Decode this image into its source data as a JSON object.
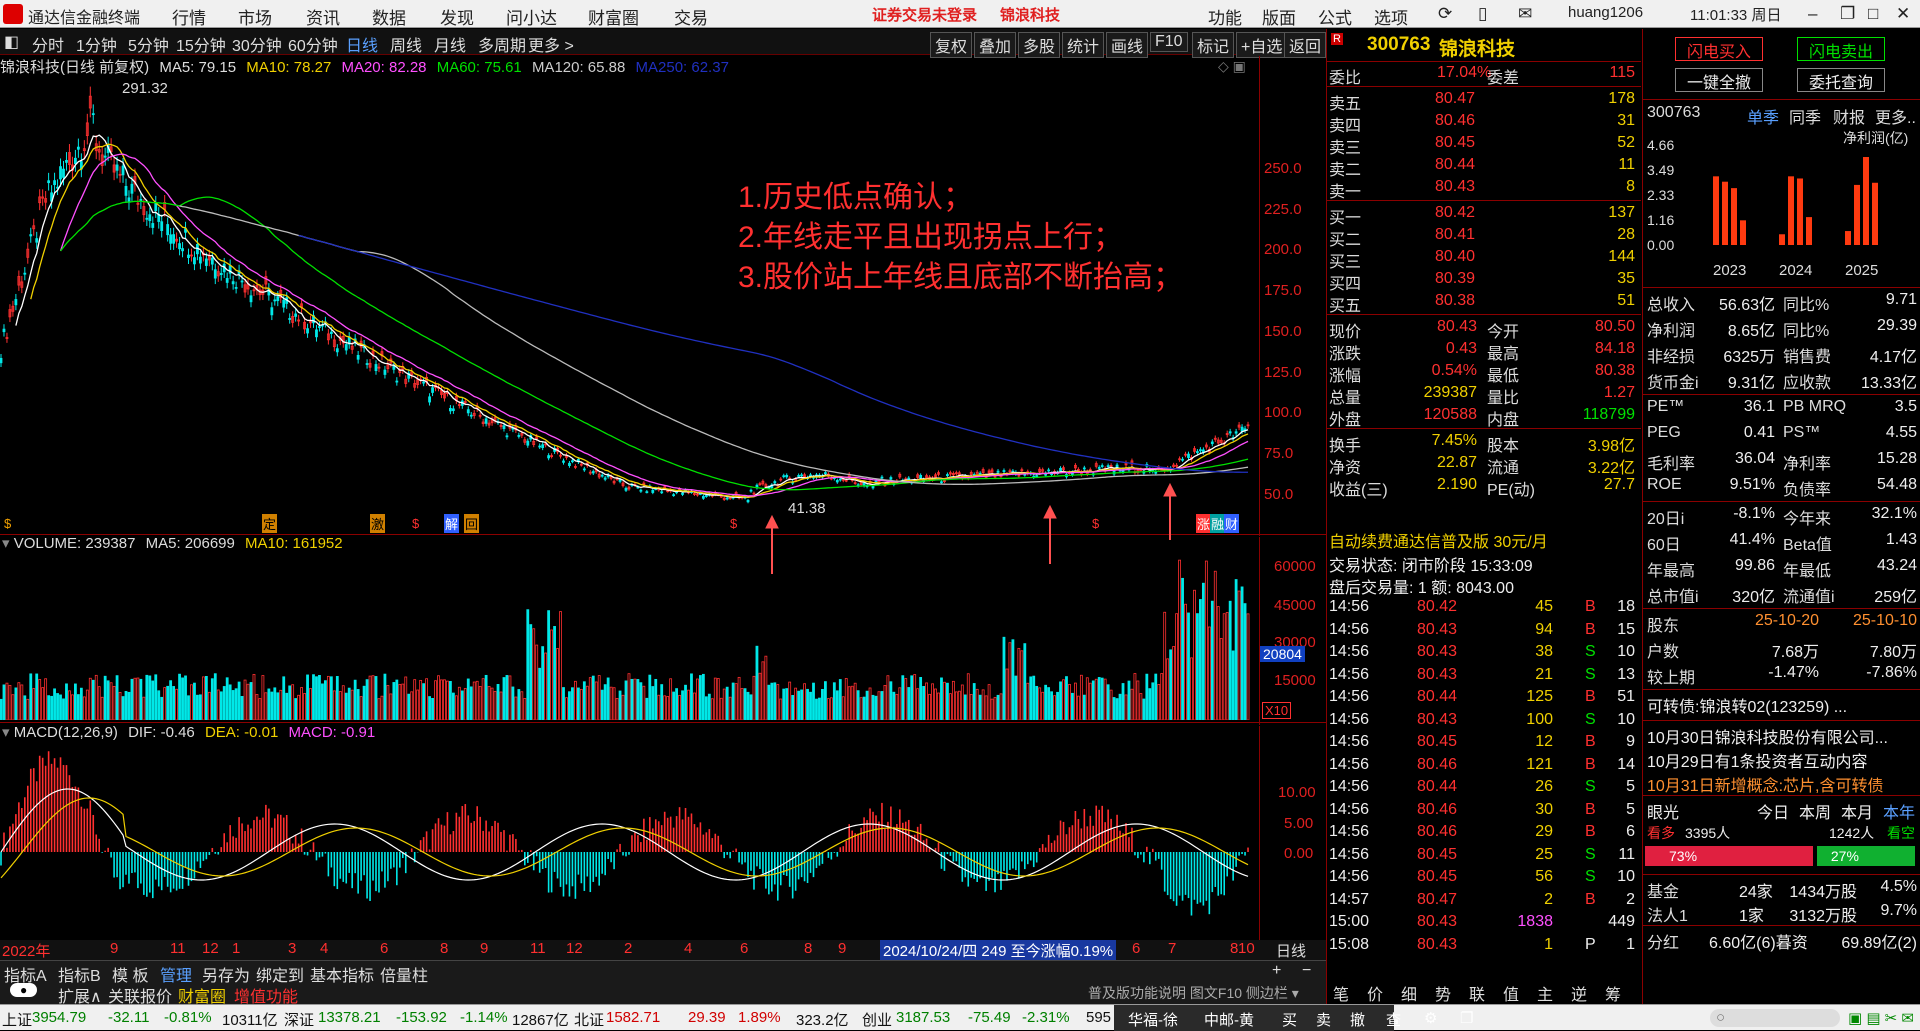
{
  "app": {
    "title": "通达信金融终端",
    "login_warning": "证券交易未登录",
    "stock_name_top": "锦浪科技",
    "user": "huang1206",
    "clock": "11:01:33 周日"
  },
  "menu": [
    "行情",
    "市场",
    "资讯",
    "数据",
    "发现",
    "问小达",
    "财富圈",
    "交易"
  ],
  "right_menu": [
    "功能",
    "版面",
    "公式",
    "选项"
  ],
  "periods": [
    "分时",
    "1分钟",
    "5分钟",
    "15分钟",
    "30分钟",
    "60分钟",
    "日线",
    "周线",
    "月线",
    "多周期",
    "更多 >"
  ],
  "tools": [
    "复权",
    "叠加",
    "多股",
    "统计",
    "画线",
    "F10",
    "标记",
    "+自选",
    "返回"
  ],
  "legend": {
    "title": "锦浪科技(日线 前复权)",
    "ma5": "MA5: 79.15",
    "ma10": "MA10: 78.27",
    "ma20": "MA20: 82.28",
    "ma60": "MA60: 75.61",
    "ma120": "MA120: 65.88",
    "ma250": "MA250: 62.37"
  },
  "price_axis": [
    "250.0",
    "225.0",
    "200.0",
    "175.0",
    "150.0",
    "125.0",
    "100.0",
    "75.0",
    "50.0"
  ],
  "annotations": {
    "high": "291.32",
    "low": "41.38",
    "line1": "1.历史低点确认；",
    "line2": "2.年线走平且出现拐点上行；",
    "line3": "3.股价站上年线且底部不断抬高；"
  },
  "markers": {
    "ding": "定",
    "ji": "激",
    "jie": "解",
    "hui": "回",
    "zhang": "涨",
    "rong": "融",
    "cai": "财"
  },
  "volume": {
    "legend_name": "VOLUME: 239387",
    "ma5": "MA5: 206699",
    "ma10": "MA10: 161952",
    "axis": [
      "60000",
      "45000",
      "30000",
      "15000"
    ],
    "current": "20804",
    "unit": "X10"
  },
  "macd": {
    "legend_name": "MACD(12,26,9)",
    "dif": "DIF: -0.46",
    "dea": "DEA: -0.01",
    "macd": "MACD: -0.91",
    "axis": [
      "10.00",
      "5.00",
      "0.00"
    ]
  },
  "date_axis": [
    "2022年",
    "9",
    "11",
    "12",
    "1",
    "3",
    "4",
    "6",
    "8",
    "9",
    "11",
    "12",
    "2",
    "4",
    "6",
    "8",
    "9",
    "6",
    "7",
    "8",
    "10"
  ],
  "date_range_note": "2024/10/24/四 249 至今涨幅0.19%",
  "period_label": "日线",
  "bottom_tabs_row1": [
    "指标A",
    "指标B",
    "模 板",
    "管理",
    "另存为",
    "绑定到",
    "基本指标",
    "倍量柱"
  ],
  "bottom_tabs_row2": [
    "扩展∧",
    "关联报价",
    "财富圈",
    "增值功能"
  ],
  "bottom_right": "普及版功能说明 图文F10 侧边栏 ▾",
  "quote": {
    "code": "300763",
    "name": "锦浪科技",
    "weibi_label": "委比",
    "weibi": "17.04%",
    "weicha_label": "委差",
    "weicha": "115",
    "sells": [
      [
        "卖五",
        "80.47",
        "178"
      ],
      [
        "卖四",
        "80.46",
        "31"
      ],
      [
        "卖三",
        "80.45",
        "52"
      ],
      [
        "卖二",
        "80.44",
        "11"
      ],
      [
        "卖一",
        "80.43",
        "8"
      ]
    ],
    "buys": [
      [
        "买一",
        "80.42",
        "137"
      ],
      [
        "买二",
        "80.41",
        "28"
      ],
      [
        "买三",
        "80.40",
        "144"
      ],
      [
        "买四",
        "80.39",
        "35"
      ],
      [
        "买五",
        "80.38",
        "51"
      ]
    ],
    "stats": [
      [
        "现价",
        "80.43",
        "今开",
        "80.50"
      ],
      [
        "涨跌",
        "0.43",
        "最高",
        "84.18"
      ],
      [
        "涨幅",
        "0.54%",
        "最低",
        "80.38"
      ],
      [
        "总量",
        "239387",
        "量比",
        "1.27"
      ],
      [
        "外盘",
        "120588",
        "内盘",
        "118799"
      ],
      [
        "换手",
        "7.45%",
        "股本",
        "3.98亿"
      ],
      [
        "净资",
        "22.87",
        "流通",
        "3.22亿"
      ],
      [
        "收益(三)",
        "2.190",
        "PE(动)",
        "27.7"
      ]
    ],
    "promo": "自动续费通达信普及版 30元/月",
    "trade_status": "交易状态: 闭市阶段 15:33:09",
    "after_hours": "盘后交易量: 1  额: 8043.00",
    "ticks": [
      [
        "14:56",
        "80.42",
        "45",
        "B",
        "18"
      ],
      [
        "14:56",
        "80.43",
        "94",
        "B",
        "15"
      ],
      [
        "14:56",
        "80.43",
        "38",
        "S",
        "10"
      ],
      [
        "14:56",
        "80.43",
        "21",
        "S",
        "13"
      ],
      [
        "14:56",
        "80.44",
        "125",
        "B",
        "51"
      ],
      [
        "14:56",
        "80.43",
        "100",
        "S",
        "10"
      ],
      [
        "14:56",
        "80.45",
        "12",
        "B",
        "9"
      ],
      [
        "14:56",
        "80.46",
        "121",
        "B",
        "14"
      ],
      [
        "14:56",
        "80.44",
        "26",
        "S",
        "5"
      ],
      [
        "14:56",
        "80.46",
        "30",
        "B",
        "5"
      ],
      [
        "14:56",
        "80.46",
        "29",
        "B",
        "6"
      ],
      [
        "14:56",
        "80.45",
        "25",
        "S",
        "11"
      ],
      [
        "14:56",
        "80.45",
        "56",
        "S",
        "10"
      ],
      [
        "14:57",
        "80.47",
        "2",
        "B",
        "2"
      ],
      [
        "15:00",
        "80.43",
        "1838",
        "",
        "449"
      ],
      [
        "15:08",
        "80.43",
        "1",
        "P",
        "1"
      ]
    ],
    "tabs": [
      "笔",
      "价",
      "细",
      "势",
      "联",
      "值",
      "主",
      "逆",
      "筹"
    ]
  },
  "info": {
    "buttons": [
      "闪电买入",
      "闪电卖出",
      "一键全撤",
      "委托查询"
    ],
    "fin_code": "300763",
    "fin_tabs": [
      "单季",
      "同季",
      "财报",
      "更多.."
    ],
    "fin_unit": "净利润(亿)",
    "fin_axis": [
      "4.66",
      "3.49",
      "2.33",
      "1.16",
      "0.00"
    ],
    "fin_years": [
      "2023",
      "2024",
      "2025"
    ],
    "fin_values": [
      3.2,
      2.95,
      2.65,
      1.15,
      0.5,
      3.2,
      3.1,
      1.3,
      0.65,
      2.8,
      4.1,
      2.9
    ],
    "rows1": [
      [
        "总收入",
        "56.63亿",
        "同比%",
        "9.71"
      ],
      [
        "净利润",
        "8.65亿",
        "同比%",
        "29.39"
      ],
      [
        "非经损",
        "6325万",
        "销售费",
        "4.17亿"
      ],
      [
        "货币金i",
        "9.31亿",
        "应收款",
        "13.33亿"
      ]
    ],
    "rows2": [
      [
        "PE™",
        "36.1",
        "PB MRQ",
        "3.5"
      ],
      [
        "PEG",
        "0.41",
        "PS™",
        "4.55"
      ],
      [
        "毛利率",
        "36.04",
        "净利率",
        "15.28"
      ],
      [
        "ROE",
        "9.51%",
        "负债率",
        "54.48"
      ]
    ],
    "rows3": [
      [
        "20日i",
        "-8.1%",
        "今年来",
        "32.1%"
      ],
      [
        "60日",
        "41.4%",
        "Beta值",
        "1.43"
      ],
      [
        "年最高",
        "99.86",
        "年最低",
        "43.24"
      ],
      [
        "总市值i",
        "320亿",
        "流通值i",
        "259亿"
      ]
    ],
    "holders": [
      [
        "股东",
        "25-10-20",
        "25-10-10"
      ],
      [
        "户数",
        "7.68万",
        "7.80万"
      ],
      [
        "较上期",
        "-1.47%",
        "-7.86%"
      ]
    ],
    "bond": "可转债:锦浪转02(123259) ...",
    "news": [
      "10月30日锦浪科技股份有限公司...",
      "10月29日有1条投资者互动内容",
      "10月31日新增概念:芯片,含可转债"
    ],
    "vision": {
      "label": "眼光",
      "tabs": [
        "今日",
        "本周",
        "本月",
        "本年"
      ],
      "bull": "看多",
      "bull_n": "3395人",
      "bear_n": "1242人",
      "bear": "看空",
      "bull_pct": 73,
      "bull_txt": "73%",
      "bear_txt": "27%"
    },
    "inst": [
      [
        "基金",
        "24家",
        "1434万股",
        "4.5%"
      ],
      [
        "法人1",
        "1家",
        "3132万股",
        "9.7%"
      ]
    ],
    "fenhong": [
      "分红",
      "6.60亿(6)暮资",
      "69.89亿(2)"
    ]
  },
  "status": {
    "sh_label": "上证",
    "sh": "3954.79",
    "sh_chg": "-32.11",
    "sh_pct": "-0.81%",
    "sh_amt": "10311亿",
    "sz_label": "深证",
    "sz": "13378.21",
    "sz_chg": "-153.92",
    "sz_pct": "-1.14%",
    "sz_amt": "12867亿",
    "bz_label": "北证",
    "bz": "1582.71",
    "bz_chg": "29.39",
    "bz_pct": "1.89%",
    "bz_amt": "323.2亿",
    "cy_label": "创业",
    "cy": "3187.53",
    "cy_chg": "-75.49",
    "cy_pct": "-2.31%",
    "cy_amt": "595",
    "tools": [
      "华福-徐",
      "中邮-黄",
      "买",
      "卖",
      "撤",
      "查"
    ]
  },
  "colors": {
    "red": "#ff3030",
    "green": "#00e000",
    "yellow": "#f0d000",
    "cyan": "#00e8e8",
    "magenta": "#ff50ff",
    "ma250": "#2030c0",
    "ma120": "#cccccc"
  }
}
